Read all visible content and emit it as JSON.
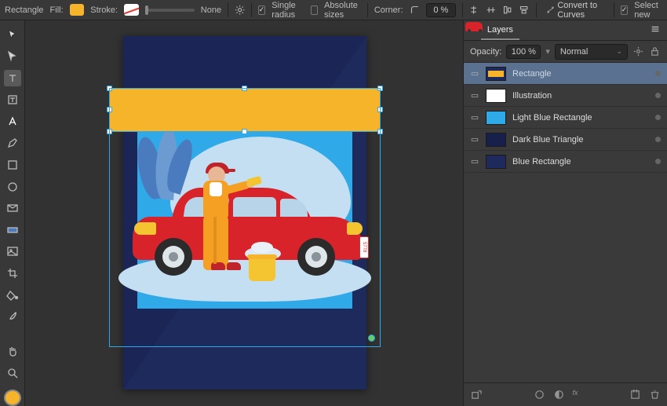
{
  "topbar": {
    "shape_label": "Rectangle",
    "fill_label": "Fill:",
    "stroke_label": "Stroke:",
    "stroke_width": "None",
    "single_radius": "Single radius",
    "absolute_sizes": "Absolute sizes",
    "corner_label": "Corner:",
    "corner_value": "0 %",
    "convert": "Convert to Curves",
    "select_new": "Select new"
  },
  "panel": {
    "tab_layers": "Layers",
    "opacity_label": "Opacity:",
    "opacity_value": "100 %",
    "blend_mode": "Normal"
  },
  "layers": [
    {
      "name": "Rectangle",
      "thumb": "t-rect",
      "selected": true
    },
    {
      "name": "Illustration",
      "thumb": "t-ill",
      "selected": false
    },
    {
      "name": "Light Blue Rectangle",
      "thumb": "t-lb",
      "selected": false
    },
    {
      "name": "Dark Blue Triangle",
      "thumb": "t-dt",
      "selected": false
    },
    {
      "name": "Blue Rectangle",
      "thumb": "t-br",
      "selected": false
    }
  ],
  "artboard": {
    "plate": "5778"
  }
}
